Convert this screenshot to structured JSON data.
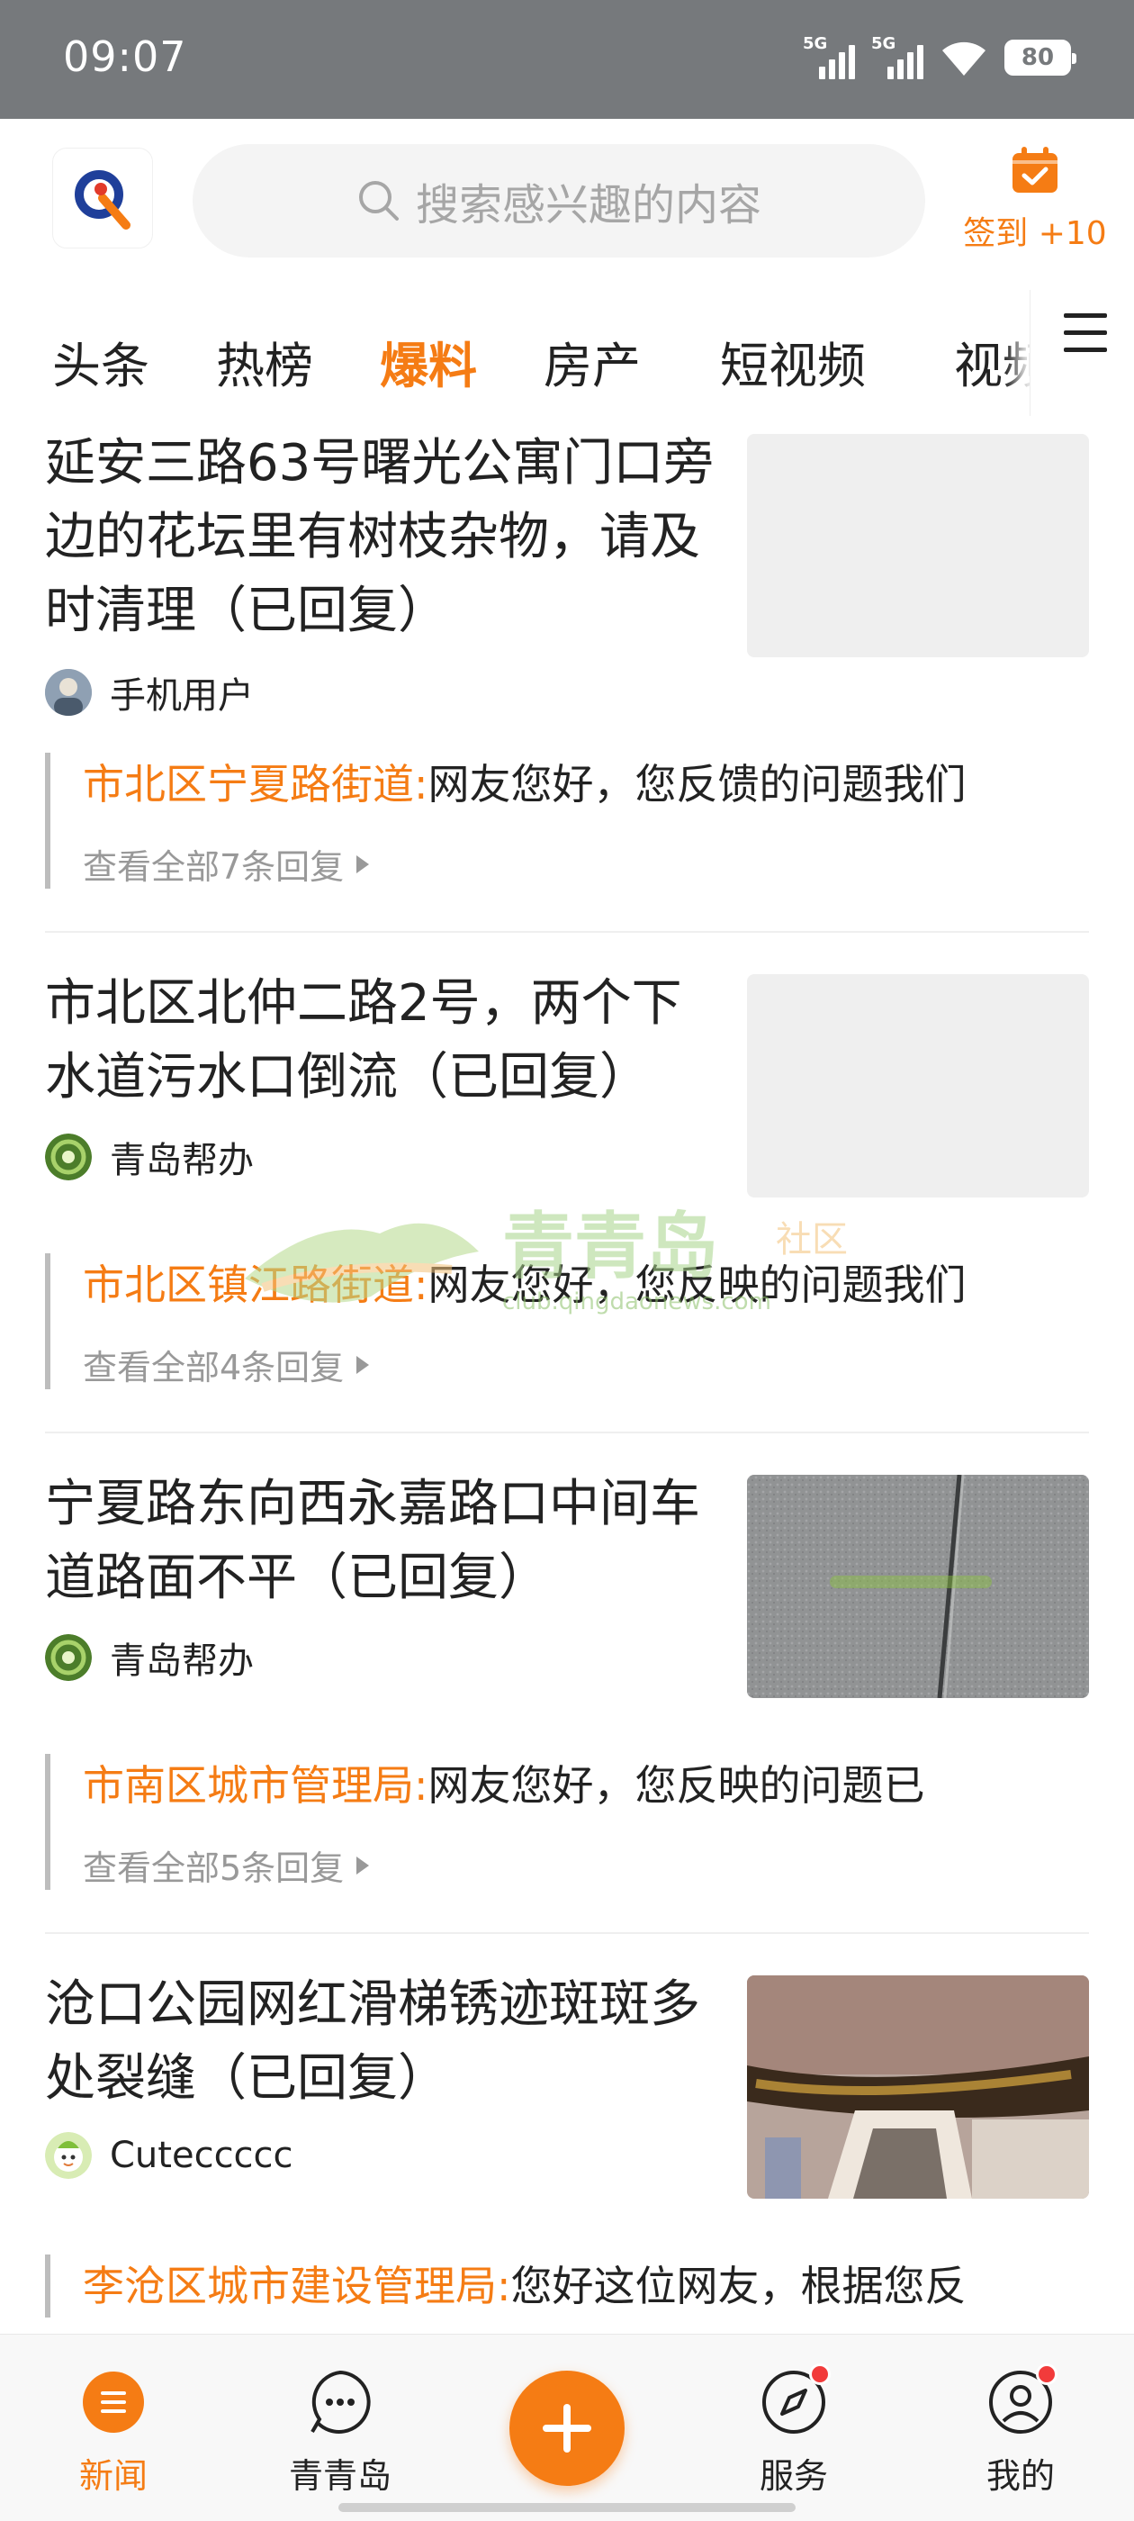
{
  "status_bar": {
    "time": "09:07",
    "signal1_label": "5G",
    "signal2_label": "5G",
    "battery": "80"
  },
  "header": {
    "search_placeholder": "搜索感兴趣的内容",
    "signin_label": "签到 +10",
    "accent_color": "#f57c14"
  },
  "tabs": [
    {
      "label": "头条"
    },
    {
      "label": "热榜"
    },
    {
      "label": "爆料"
    },
    {
      "label": "房产"
    },
    {
      "label": "短视频"
    },
    {
      "label": "视频"
    }
  ],
  "active_tab": "爆料",
  "feed": [
    {
      "title": "延安三路63号曙光公寓门口旁边的花坛里有树枝杂物，请及时清理（已回复）",
      "author": "手机用户",
      "reply_dept": "市北区宁夏路街道:",
      "reply_text": "网友您好，您反馈的问题我们",
      "reply_more": "查看全部7条回复"
    },
    {
      "title": "市北区北仲二路2号，两个下水道污水口倒流（已回复）",
      "author": "青岛帮办",
      "reply_dept": "市北区镇江路街道:",
      "reply_text": "网友您好，您反映的问题我们",
      "reply_more": "查看全部4条回复"
    },
    {
      "title": "宁夏路东向西永嘉路口中间车道路面不平（已回复）",
      "author": "青岛帮办",
      "reply_dept": "市南区城市管理局:",
      "reply_text": "网友您好，您反映的问题已",
      "reply_more": "查看全部5条回复"
    },
    {
      "title": "沧口公园网红滑梯锈迹斑斑多处裂缝（已回复）",
      "author": "Cuteccccc",
      "reply_dept": "李沧区城市建设管理局:",
      "reply_text": "您好这位网友，根据您反"
    }
  ],
  "watermark": {
    "name": "青青岛",
    "tag": "社区",
    "url": "club.qingdaonews.com"
  },
  "bottom_nav": [
    {
      "label": "新闻",
      "icon": "news-icon"
    },
    {
      "label": "青青岛",
      "icon": "chat-icon"
    },
    {
      "label": "服务",
      "icon": "compass-icon"
    },
    {
      "label": "我的",
      "icon": "profile-icon"
    }
  ]
}
